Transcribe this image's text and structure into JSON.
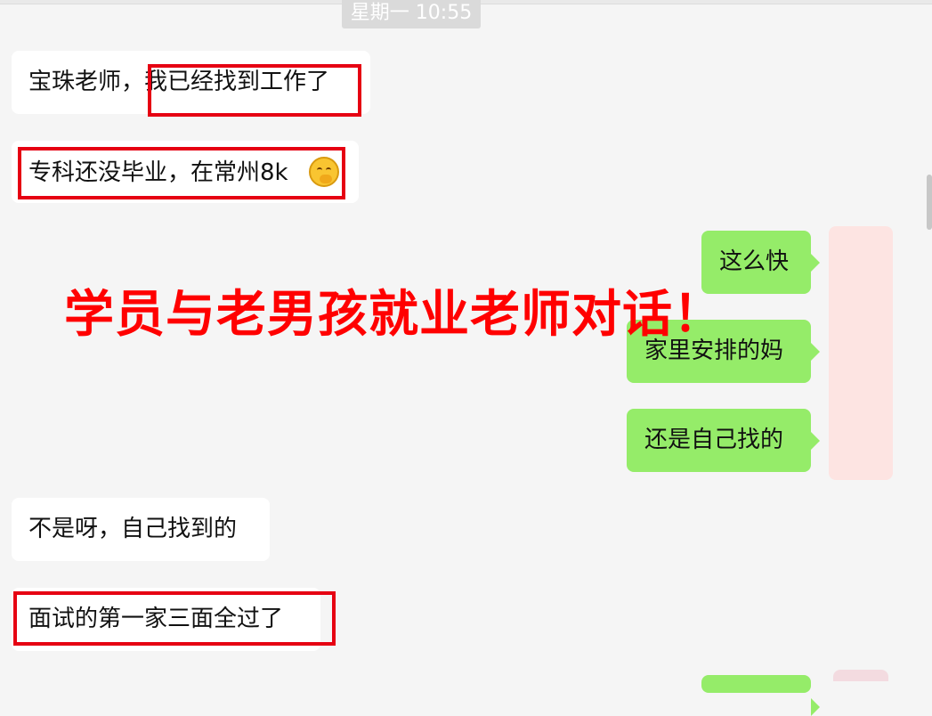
{
  "header": {
    "timestamp": "星期一 10:55"
  },
  "messages": [
    {
      "side": "in",
      "text": "宝珠老师，我已经找到工作了"
    },
    {
      "side": "in",
      "text": "专科还没毕业，在常州8k",
      "emoji": "hand-over-mouth-emoji"
    },
    {
      "side": "out",
      "text": "这么快"
    },
    {
      "side": "out",
      "text": "家里安排的妈"
    },
    {
      "side": "out",
      "text": "还是自己找的"
    },
    {
      "side": "in",
      "text": "不是呀，自己找到的"
    },
    {
      "side": "in",
      "text": "面试的第一家三面全过了"
    }
  ],
  "overlay": {
    "text": "学员与老男孩就业老师对话！",
    "color": "#ff0000"
  },
  "colors": {
    "incoming_bubble": "#ffffff",
    "outgoing_bubble": "#95ec69",
    "highlight_box": "#e60012",
    "background": "#f5f5f5"
  }
}
